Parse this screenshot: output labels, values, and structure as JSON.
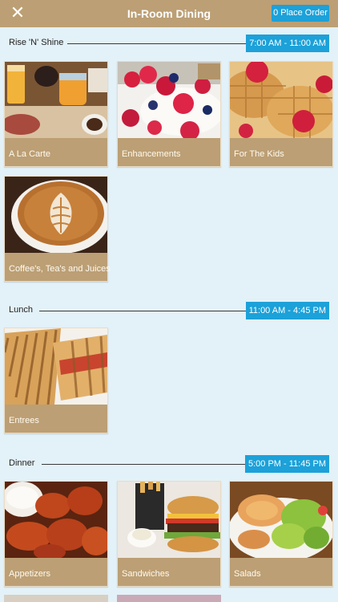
{
  "header": {
    "title": "In-Room Dining",
    "close_icon": "close-icon",
    "order_button_label": "0 Place Order",
    "bar_color": "#bc9f74",
    "accent_color": "#1ca1d9"
  },
  "sections": [
    {
      "label": "Rise 'N' Shine",
      "hours": "7:00 AM - 11:00 AM",
      "items": [
        "A La Carte",
        "Enhancements",
        "For The Kids",
        "Coffee's, Tea's and Juices"
      ]
    },
    {
      "label": "Lunch",
      "hours": "11:00 AM - 4:45 PM",
      "items": [
        "Entrees"
      ]
    },
    {
      "label": "Dinner",
      "hours": "5:00 PM - 11:45 PM",
      "items": [
        "Appetizers",
        "Sandwiches",
        "Salads"
      ]
    }
  ]
}
